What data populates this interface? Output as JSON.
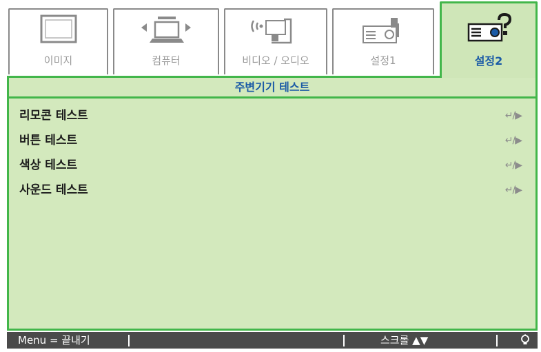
{
  "tabs": [
    {
      "label": "이미지",
      "icon": "image-icon",
      "active": false
    },
    {
      "label": "컴퓨터",
      "icon": "computer-icon",
      "active": false
    },
    {
      "label": "비디오 / 오디오",
      "icon": "video-audio-icon",
      "active": false
    },
    {
      "label": "설정1",
      "icon": "setup1-projector-icon",
      "active": false
    },
    {
      "label": "설정2",
      "icon": "setup2-projector-icon",
      "active": true
    }
  ],
  "panel": {
    "header": "주변기기 테스트",
    "items": [
      {
        "label": "리모콘 테스트",
        "action": "↵/▶"
      },
      {
        "label": "버튼 테스트",
        "action": "↵/▶"
      },
      {
        "label": "색상 테스트",
        "action": "↵/▶"
      },
      {
        "label": "사운드 테스트",
        "action": "↵/▶"
      }
    ]
  },
  "footer": {
    "menu_hint": "Menu = 끝내기",
    "scroll_hint": "스크롤 ▲▼",
    "bulb_icon": "lightbulb-icon"
  },
  "colors": {
    "accent_green": "#42b64a",
    "panel_bg": "#d3e9bd",
    "active_tab_text": "#1a5aa6",
    "footer_bg": "#4a4a4a"
  }
}
